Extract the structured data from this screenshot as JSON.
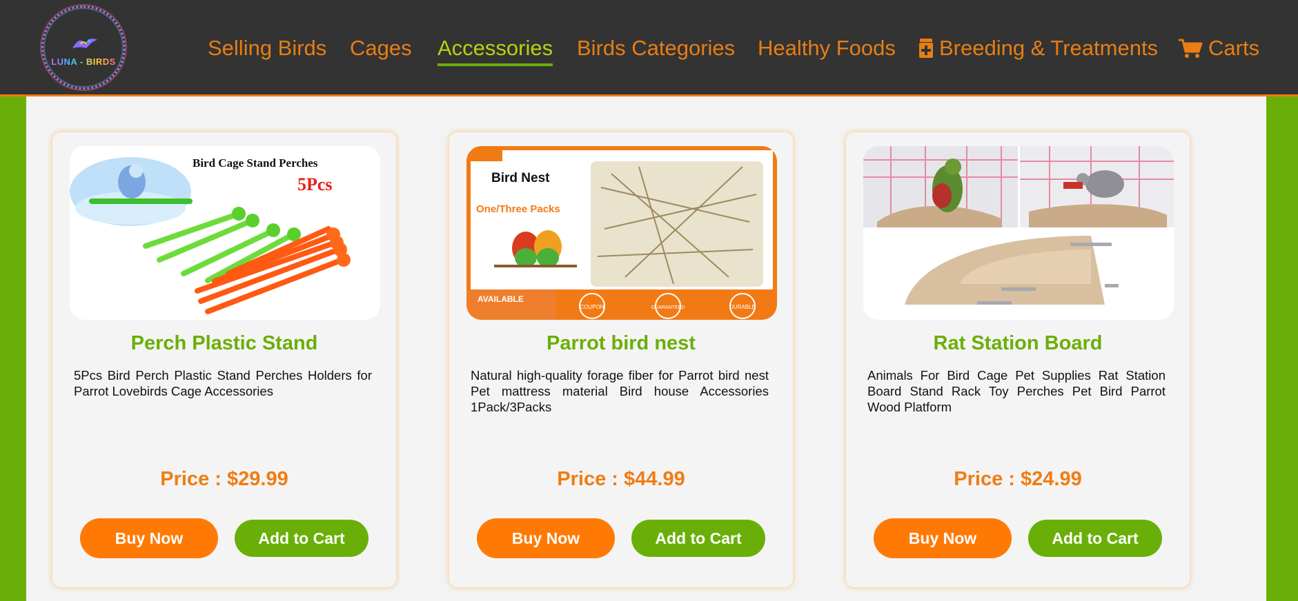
{
  "brand": {
    "logo_text": "LUNA - BIRDS"
  },
  "nav": [
    {
      "label": "Selling Birds",
      "icon": ""
    },
    {
      "label": "Cages",
      "icon": ""
    },
    {
      "label": "Accessories",
      "icon": "",
      "active": true
    },
    {
      "label": "Birds Categories",
      "icon": ""
    },
    {
      "label": "Healthy Foods",
      "icon": ""
    },
    {
      "label": "Breeding & Treatments",
      "icon": "medicine-bottle-icon"
    },
    {
      "label": "Carts",
      "icon": "cart-icon"
    }
  ],
  "colors": {
    "accent_green": "#6aaf08",
    "accent_orange": "#f07c12",
    "navbar_bg": "#333333",
    "active_nav": "#b6d40a"
  },
  "products": [
    {
      "title": "Perch Plastic Stand",
      "description": "5Pcs Bird Perch Plastic Stand Perches Holders for Parrot Lovebirds Cage Accessories",
      "price": "Price : $29.99",
      "buy_label": "Buy Now",
      "cart_label": "Add to Cart",
      "image_text": {
        "heading": "Bird Cage Stand Perches",
        "badge": "5Pcs"
      }
    },
    {
      "title": "Parrot bird nest",
      "description": "Natural high-quality forage fiber for Parrot bird nest Pet mattress material Bird house Accessories 1Pack/3Packs",
      "price": "Price : $44.99",
      "buy_label": "Buy Now",
      "cart_label": "Add to Cart",
      "image_text": {
        "heading": "Bird Nest",
        "sub": "One/Three Packs",
        "available": "AVAILABLE",
        "seals": [
          "COUPON",
          "GUARANTEED",
          "DURABLE"
        ]
      }
    },
    {
      "title": "Rat Station Board",
      "description": "Animals For Bird Cage Pet Supplies Rat Station Board Stand Rack Toy Perches Pet Bird Parrot Wood Platform",
      "price": "Price : $24.99",
      "buy_label": "Buy Now",
      "cart_label": "Add to Cart"
    }
  ]
}
